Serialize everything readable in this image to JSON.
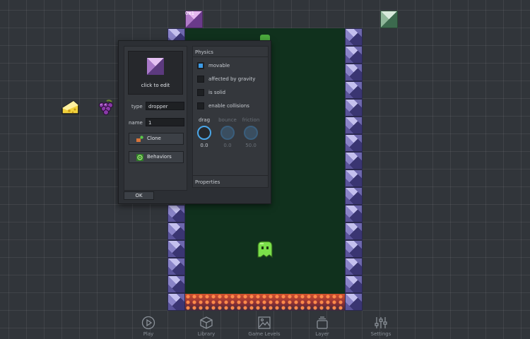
{
  "level": {
    "dropper_label": "0x1"
  },
  "dialog": {
    "click_to_edit": "click to edit",
    "type_label": "type",
    "type_value": "dropper",
    "name_label": "name",
    "name_value": "1",
    "clone_label": "Clone",
    "behaviors_label": "Behaviors",
    "ok_label": "OK",
    "physics": {
      "title": "Physics",
      "checks": [
        {
          "label": "movable",
          "checked": true
        },
        {
          "label": "affected by gravity",
          "checked": false
        },
        {
          "label": "is solid",
          "checked": false
        },
        {
          "label": "enable collisions",
          "checked": false
        }
      ],
      "knobs": [
        {
          "label": "drag",
          "value": "0.0",
          "active": true
        },
        {
          "label": "bounce",
          "value": "0.0",
          "active": false
        },
        {
          "label": "friction",
          "value": "50.0",
          "active": false
        }
      ]
    },
    "properties_title": "Properties"
  },
  "nav": [
    {
      "label": "Play",
      "icon": "play-icon"
    },
    {
      "label": "Library",
      "icon": "cube-icon"
    },
    {
      "label": "Game Levels",
      "icon": "image-icon"
    },
    {
      "label": "Layer",
      "icon": "layers-icon"
    },
    {
      "label": "Settings",
      "icon": "sliders-icon"
    }
  ],
  "colors": {
    "accent": "#3c9be6",
    "level_bg": "#10311d",
    "canvas_bg": "#31353a"
  }
}
